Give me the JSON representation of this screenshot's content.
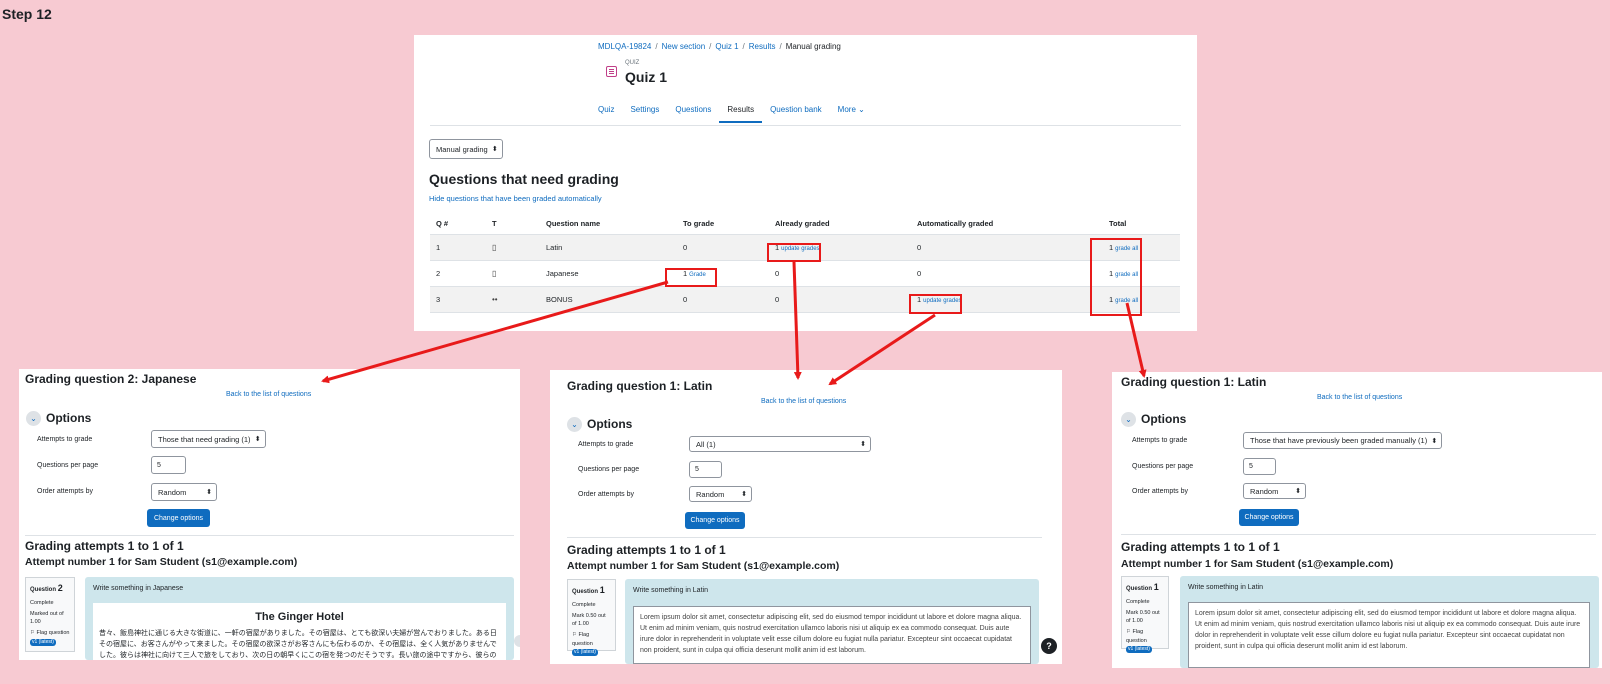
{
  "step_title": "Step 12",
  "top": {
    "breadcrumb": [
      "MDLQA-19824",
      "New section",
      "Quiz 1",
      "Results",
      "Manual grading"
    ],
    "kicker": "QUIZ",
    "title": "Quiz 1",
    "tabs": [
      "Quiz",
      "Settings",
      "Questions",
      "Results",
      "Question bank",
      "More ⌄"
    ],
    "jump_select": "Manual grading",
    "heading": "Questions that need grading",
    "hide_link": "Hide questions that have been graded automatically",
    "table": {
      "headers": [
        "Q #",
        "T",
        "Question name",
        "To grade",
        "Already graded",
        "Automatically graded",
        "Total"
      ],
      "rows": [
        {
          "num": "1",
          "icon": "▯",
          "name": "Latin",
          "to_grade": "0",
          "already": "1",
          "already_link": "update grades",
          "auto": "0",
          "auto_link": "",
          "total": "1",
          "total_link": "grade all"
        },
        {
          "num": "2",
          "icon": "▯",
          "name": "Japanese",
          "to_grade": "1",
          "to_grade_link": "Grade",
          "already": "0",
          "already_link": "",
          "auto": "0",
          "auto_link": "",
          "total": "1",
          "total_link": "grade all"
        },
        {
          "num": "3",
          "icon": "••",
          "name": "BONUS",
          "to_grade": "0",
          "already": "0",
          "already_link": "",
          "auto": "1",
          "auto_link": "update grades",
          "total": "1",
          "total_link": "grade all"
        }
      ]
    }
  },
  "panels": [
    {
      "title": "Grading question 2: Japanese",
      "back": "Back to the list of questions",
      "options": "Options",
      "attempts_label": "Attempts to grade",
      "attempts_value": "Those that need grading (1)",
      "perpage_label": "Questions per page",
      "perpage_value": "5",
      "order_label": "Order attempts by",
      "order_value": "Random",
      "button": "Change options",
      "grading_attempts": "Grading attempts 1 to 1 of 1",
      "attempt": "Attempt number 1 for Sam Student (s1@example.com)",
      "q_label": "Question",
      "q_num": "2",
      "status": "Complete",
      "marks": "Marked out of 1.00",
      "flag": "Flag question",
      "version": "v1 (latest)",
      "prompt": "Write something in Japanese",
      "answer_title": "The Ginger Hotel",
      "answer": "昔々、飯島神社に通じる大きな街道に、一軒の宿屋がありました。その宿屋は、とても欲深い夫婦が営んでおりました。ある日その宿屋に、お客さんがやって来ました。その宿屋の欲深さがお客さんにも伝わるのか、その宿屋は、全く人気がありませんでした。彼らは神社に向けて三人で旅をしており、次の日の朝早くにこの宿を発つのだそうです。長い旅の途中ですから、彼らの"
    },
    {
      "title": "Grading question 1: Latin",
      "back": "Back to the list of questions",
      "options": "Options",
      "attempts_label": "Attempts to grade",
      "attempts_value": "All (1)",
      "perpage_label": "Questions per page",
      "perpage_value": "5",
      "order_label": "Order attempts by",
      "order_value": "Random",
      "button": "Change options",
      "grading_attempts": "Grading attempts 1 to 1 of 1",
      "attempt": "Attempt number 1 for Sam Student (s1@example.com)",
      "q_label": "Question",
      "q_num": "1",
      "status": "Complete",
      "marks": "Mark 0.50 out of 1.00",
      "flag": "Flag question",
      "version": "v1 (latest)",
      "prompt": "Write something in Latin",
      "answer": "Lorem ipsum dolor sit amet, consectetur adipiscing elit, sed do eiusmod tempor incididunt ut labore et dolore magna aliqua. Ut enim ad minim veniam, quis nostrud exercitation ullamco laboris nisi ut aliquip ex ea commodo consequat. Duis aute irure dolor in reprehenderit in voluptate velit esse cillum dolore eu fugiat nulla pariatur. Excepteur sint occaecat cupidatat non proident, sunt in culpa qui officia deserunt mollit anim id est laborum.",
      "help": "?"
    },
    {
      "title": "Grading question 1: Latin",
      "back": "Back to the list of questions",
      "options": "Options",
      "attempts_label": "Attempts to grade",
      "attempts_value": "Those that have previously been graded manually (1)",
      "perpage_label": "Questions per page",
      "perpage_value": "5",
      "order_label": "Order attempts by",
      "order_value": "Random",
      "button": "Change options",
      "grading_attempts": "Grading attempts 1 to 1 of 1",
      "attempt": "Attempt number 1 for Sam Student (s1@example.com)",
      "q_label": "Question",
      "q_num": "1",
      "status": "Complete",
      "marks": "Mark 0.50 out of 1.00",
      "flag": "Flag question",
      "version": "v1 (latest)",
      "prompt": "Write something in Latin",
      "answer": "Lorem ipsum dolor sit amet, consectetur adipiscing elit, sed do eiusmod tempor incididunt ut labore et dolore magna aliqua. Ut enim ad minim veniam, quis nostrud exercitation ullamco laboris nisi ut aliquip ex ea commodo consequat. Duis aute irure dolor in reprehenderit in voluptate velit esse cillum dolore eu fugiat nulla pariatur. Excepteur sint occaecat cupidatat non proident, sunt in culpa qui officia deserunt mollit anim id est laborum."
    }
  ],
  "colors": {
    "background": "#f7cad2",
    "link": "#0f6cbf",
    "annotation": "#e81a1a",
    "answer_area": "#cee6ec"
  }
}
